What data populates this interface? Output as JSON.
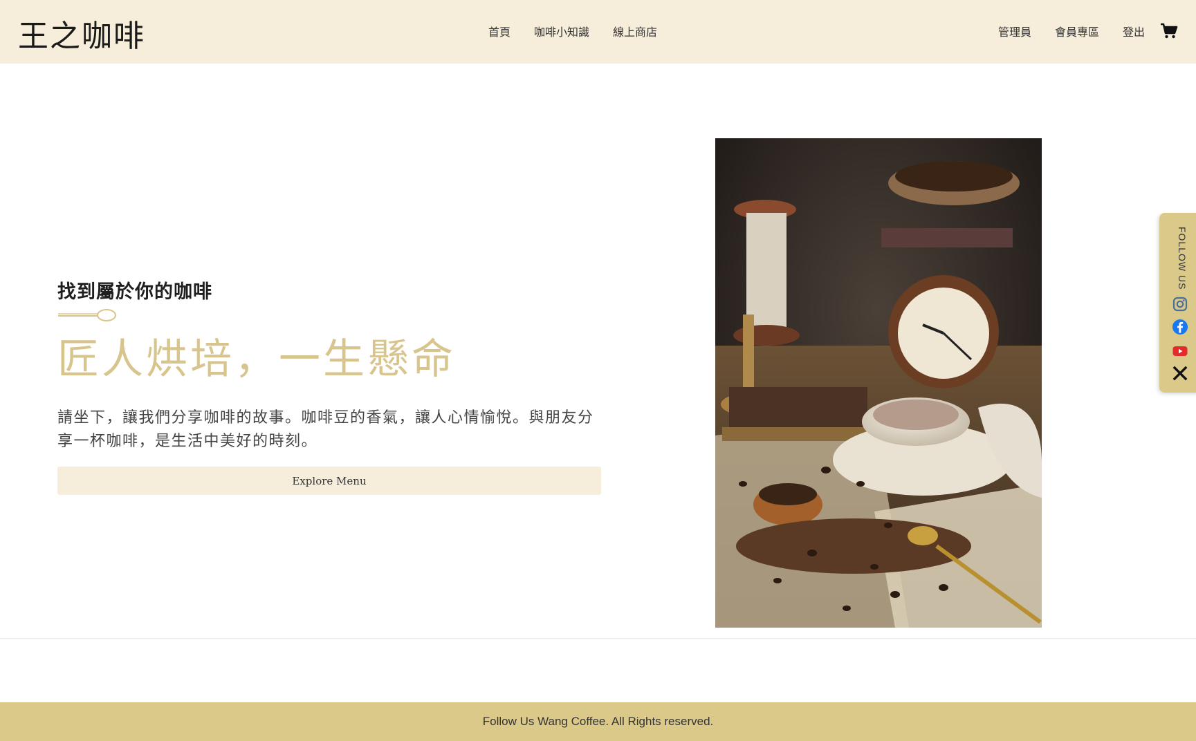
{
  "header": {
    "logo": "王之咖啡",
    "nav_center": [
      "首頁",
      "咖啡小知識",
      "線上商店"
    ],
    "nav_right": [
      "管理員",
      "會員專區",
      "登出"
    ]
  },
  "hero": {
    "eyebrow": "找到屬於你的咖啡",
    "headline": "匠人烘培，一生懸命",
    "description": "請坐下，讓我們分享咖啡的故事。咖啡豆的香氣，讓人心情愉悅。與朋友分享一杯咖啡，是生活中美好的時刻。",
    "cta": "Explore Menu"
  },
  "sidebar": {
    "label": "FOLLOW US",
    "icons": [
      "instagram-icon",
      "facebook-icon",
      "youtube-icon",
      "x-icon"
    ]
  },
  "footer": {
    "text": "Follow Us Wang Coffee. All Rights reserved."
  },
  "colors": {
    "header_bg": "#f6eedb",
    "accent_gold": "#d8c58e",
    "footer_bg": "#dbc98a"
  }
}
